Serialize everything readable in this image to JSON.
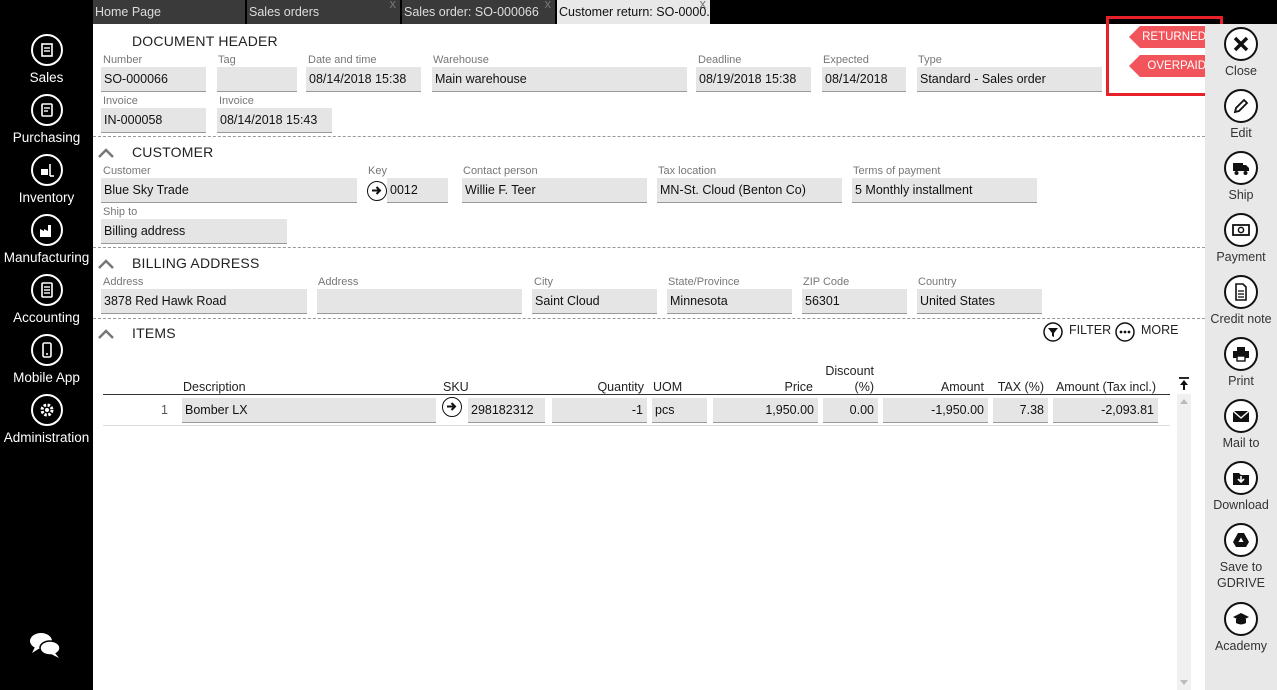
{
  "nav": [
    {
      "label": "Sales",
      "icon": "sales-icon"
    },
    {
      "label": "Purchasing",
      "icon": "purchasing-icon"
    },
    {
      "label": "Inventory",
      "icon": "inventory-icon"
    },
    {
      "label": "Manufacturing",
      "icon": "manufacturing-icon"
    },
    {
      "label": "Accounting",
      "icon": "accounting-icon"
    },
    {
      "label": "Mobile App",
      "icon": "mobile-app-icon"
    },
    {
      "label": "Administration",
      "icon": "gear-icon"
    }
  ],
  "tabs": [
    {
      "label": "Home Page"
    },
    {
      "label": "Sales orders"
    },
    {
      "label": "Sales order: SO-000066"
    },
    {
      "label": "Customer return: SO-0000..."
    }
  ],
  "tab_close": "x",
  "header": {
    "title": "DOCUMENT HEADER",
    "number_label": "Number",
    "number": "SO-000066",
    "tag_label": "Tag",
    "tag": "",
    "datetime_label": "Date and time",
    "datetime": "08/14/2018 15:38",
    "warehouse_label": "Warehouse",
    "warehouse": "Main warehouse",
    "deadline_label": "Deadline",
    "deadline": "08/19/2018 15:38",
    "expected_label": "Expected",
    "expected": "08/14/2018",
    "type_label": "Type",
    "type": "Standard - Sales order",
    "invoice_label": "Invoice",
    "invoice": "IN-000058",
    "invoice_date_label": "Invoice",
    "invoice_date": "08/14/2018 15:43"
  },
  "status": {
    "returned": "RETURNED",
    "overpaid": "OVERPAID"
  },
  "customer": {
    "title": "CUSTOMER",
    "customer_label": "Customer",
    "customer": "Blue Sky Trade",
    "key_label": "Key",
    "key": "0012",
    "contact_label": "Contact person",
    "contact": "Willie F. Teer",
    "tax_location_label": "Tax location",
    "tax_location": "MN-St. Cloud (Benton Co)",
    "terms_label": "Terms of payment",
    "terms": "5 Monthly installment",
    "ship_to_label": "Ship to",
    "ship_to": "Billing address"
  },
  "billing": {
    "title": "BILLING ADDRESS",
    "address_label": "Address",
    "address": "3878 Red Hawk Road",
    "address2_label": "Address",
    "address2": "",
    "city_label": "City",
    "city": "Saint Cloud",
    "state_label": "State/Province",
    "state": "Minnesota",
    "zip_label": "ZIP Code",
    "zip": "56301",
    "country_label": "Country",
    "country": "United States"
  },
  "items": {
    "title": "ITEMS",
    "filter": "FILTER",
    "more": "MORE",
    "columns": {
      "description": "Description",
      "sku": "SKU",
      "quantity": "Quantity",
      "uom": "UOM",
      "price": "Price",
      "discount_line1": "Discount",
      "discount_line2": "(%)",
      "amount": "Amount",
      "tax": "TAX (%)",
      "amount_tax": "Amount (Tax incl.)"
    },
    "rows": [
      {
        "no": "1",
        "description": "Bomber LX",
        "sku": "298182312",
        "quantity": "-1",
        "uom": "pcs",
        "price": "1,950.00",
        "discount": "0.00",
        "amount": "-1,950.00",
        "tax": "7.38",
        "amount_tax": "-2,093.81"
      }
    ]
  },
  "actions": [
    {
      "label": "Close",
      "icon": "close-icon"
    },
    {
      "label": "Edit",
      "icon": "pencil-icon"
    },
    {
      "label": "Ship",
      "icon": "truck-icon"
    },
    {
      "label": "Payment",
      "icon": "payment-icon"
    },
    {
      "label": "Credit note",
      "icon": "document-icon"
    },
    {
      "label": "Print",
      "icon": "printer-icon"
    },
    {
      "label": "Mail to",
      "icon": "mail-icon"
    },
    {
      "label": "Download",
      "icon": "download-icon"
    },
    {
      "label": "Save to GDRIVE",
      "icon": "gdrive-icon"
    },
    {
      "label": "Academy",
      "icon": "academy-icon"
    }
  ],
  "colors": {
    "ribbon": "#f2545b",
    "highlight": "#e8202a",
    "sidebar": "#000000",
    "toolbar": "#e8e8e8",
    "field": "#e5e5e5"
  }
}
